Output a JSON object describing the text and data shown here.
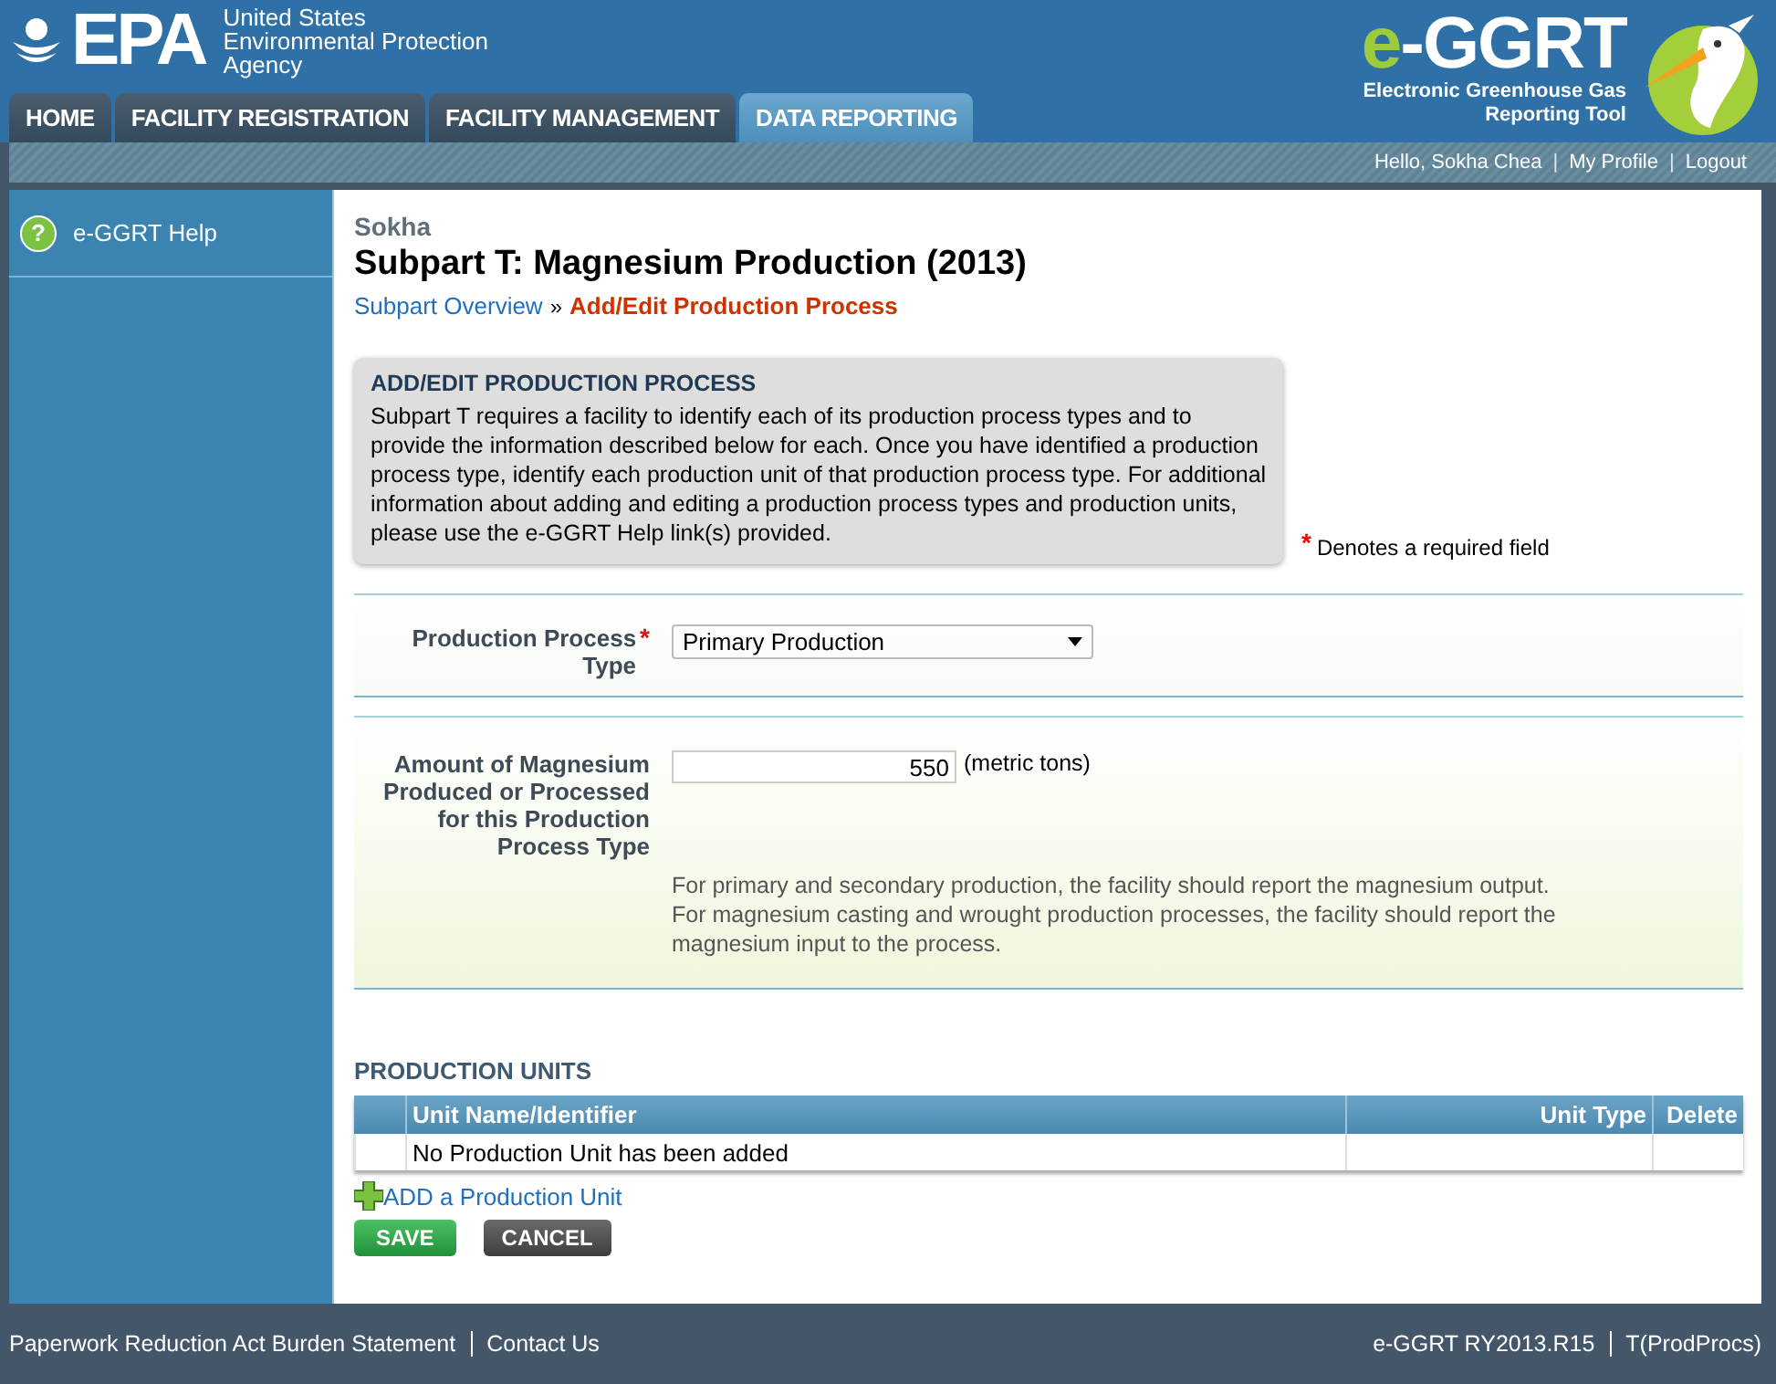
{
  "header": {
    "agency_logo": {
      "mark": "EPA",
      "lines": [
        "United States",
        "Environmental Protection",
        "Agency"
      ]
    },
    "app_logo": {
      "accent": "e",
      "rest": "-GGRT",
      "tagline": [
        "Electronic Greenhouse Gas",
        "Reporting Tool"
      ]
    }
  },
  "tabs": [
    {
      "label": "HOME",
      "selected": false
    },
    {
      "label": "FACILITY REGISTRATION",
      "selected": false
    },
    {
      "label": "FACILITY MANAGEMENT",
      "selected": false
    },
    {
      "label": "DATA REPORTING",
      "selected": true
    }
  ],
  "user_bar": {
    "greeting": "Hello, Sokha Chea",
    "separator": "|",
    "links": [
      "My Profile",
      "Logout"
    ]
  },
  "sidebar": {
    "items": [
      {
        "label": "e-GGRT Help",
        "icon": "?"
      }
    ]
  },
  "page": {
    "facility": "Sokha",
    "title": "Subpart T: Magnesium Production (2013)",
    "breadcrumb": [
      {
        "label": "Subpart Overview",
        "current": false
      },
      {
        "label": "Add/Edit Production Process",
        "current": true
      }
    ],
    "breadcrumb_separator": "»",
    "info_box": {
      "title": "ADD/EDIT PRODUCTION PROCESS",
      "text": "Subpart T requires a facility to identify each of its production process types and to provide the information described below for each. Once you have identified a production process type, identify each production unit of that production process type. For additional information about adding and editing a production process types and production units, please use the e-GGRT Help link(s) provided."
    },
    "required_note": {
      "marker": "*",
      "text": "Denotes a required field"
    }
  },
  "form": {
    "fields": [
      {
        "kind": "select",
        "label": "Production Process Type",
        "required": true,
        "value": "Primary Production"
      },
      {
        "kind": "number",
        "label": "Amount of Magnesium Produced or Processed for this Production Process Type",
        "required": false,
        "value": "550",
        "unit": "(metric tons)",
        "help": "For primary and secondary production, the facility should report the magnesium output. For magnesium casting and wrought production processes, the facility should report the magnesium input to the process."
      }
    ]
  },
  "production_units": {
    "title": "PRODUCTION UNITS",
    "columns": [
      "Unit Name/Identifier",
      "Unit Type",
      "Delete"
    ],
    "empty_message": "No Production Unit has been added",
    "add_link": "ADD a Production Unit"
  },
  "buttons": [
    {
      "label": "SAVE",
      "kind": "primary"
    },
    {
      "label": "CANCEL",
      "kind": "secondary"
    }
  ],
  "footer": {
    "left": [
      "Paperwork Reduction Act Burden Statement",
      "Contact Us"
    ],
    "right": [
      "e-GGRT RY2013.R15",
      "T(ProdProcs)"
    ]
  }
}
